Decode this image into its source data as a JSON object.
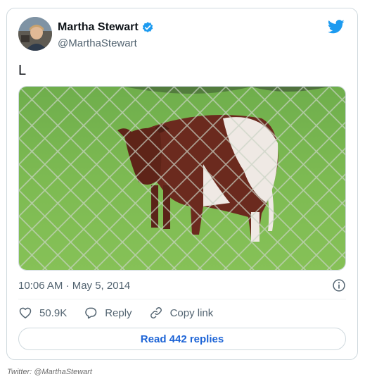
{
  "tweet": {
    "author_name": "Martha Stewart",
    "author_handle": "@MarthaStewart",
    "text": "L",
    "timestamp": "10:06 AM · May 5, 2014",
    "likes": "50.9K",
    "reply_label": "Reply",
    "copy_link_label": "Copy link",
    "read_replies_label": "Read 442 replies"
  },
  "caption": "Twitter: @MarthaStewart",
  "icons": {
    "verified": "verified-badge-icon",
    "brand": "twitter-bird-icon",
    "info": "info-icon",
    "like": "heart-icon",
    "reply": "speech-bubble-icon",
    "copy_link": "link-icon"
  },
  "colors": {
    "accent": "#1d9bf0",
    "link_text": "#1d64d6",
    "border": "#cfd9de",
    "secondary_text": "#536471"
  }
}
